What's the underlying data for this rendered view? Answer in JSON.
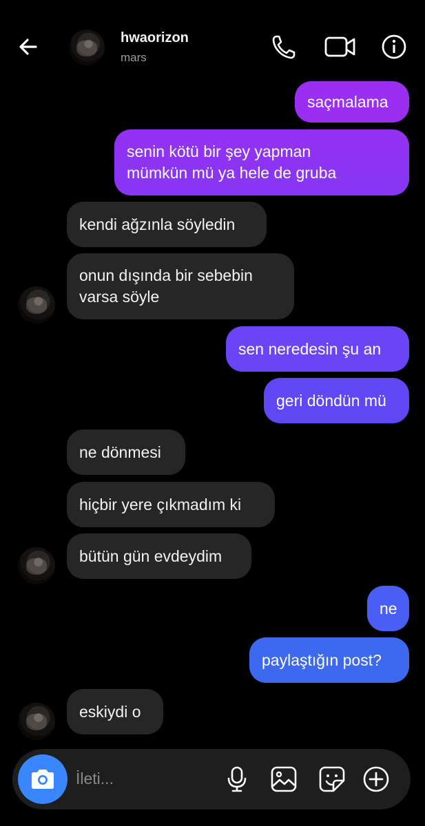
{
  "header": {
    "username": "hwaorizon",
    "subtitle": "mars",
    "icons": [
      "back-arrow-icon",
      "phone-icon",
      "video-camera-icon",
      "info-icon"
    ]
  },
  "messages": [
    {
      "side": "out",
      "text": "saçmalama"
    },
    {
      "side": "out",
      "text": "senin kötü bir şey yapman\nmümkün mü ya hele de gruba"
    },
    {
      "side": "in",
      "text": "kendi ağzınla söyledin"
    },
    {
      "side": "in",
      "text": "onun dışında bir sebebin\nvarsa söyle"
    },
    {
      "side": "out",
      "text": "sen neredesin şu an"
    },
    {
      "side": "out",
      "text": "geri döndün mü"
    },
    {
      "side": "in",
      "text": "ne dönmesi"
    },
    {
      "side": "in",
      "text": "hiçbir yere çıkmadım ki"
    },
    {
      "side": "in",
      "text": "bütün gün evdeydim"
    },
    {
      "side": "out",
      "text": "ne"
    },
    {
      "side": "out",
      "text": "paylaştığın post?"
    },
    {
      "side": "in",
      "text": "eskiydi o"
    }
  ],
  "composer": {
    "placeholder": "İleti...",
    "icons": [
      "camera-icon",
      "microphone-icon",
      "gallery-icon",
      "sticker-icon",
      "plus-icon"
    ]
  },
  "colors": {
    "background": "#000000",
    "incoming_bubble": "#262626",
    "outgoing_gradient_top": "#9b2ff2",
    "outgoing_gradient_bottom": "#3a6ef0",
    "camera_button": "#3a86ff"
  }
}
